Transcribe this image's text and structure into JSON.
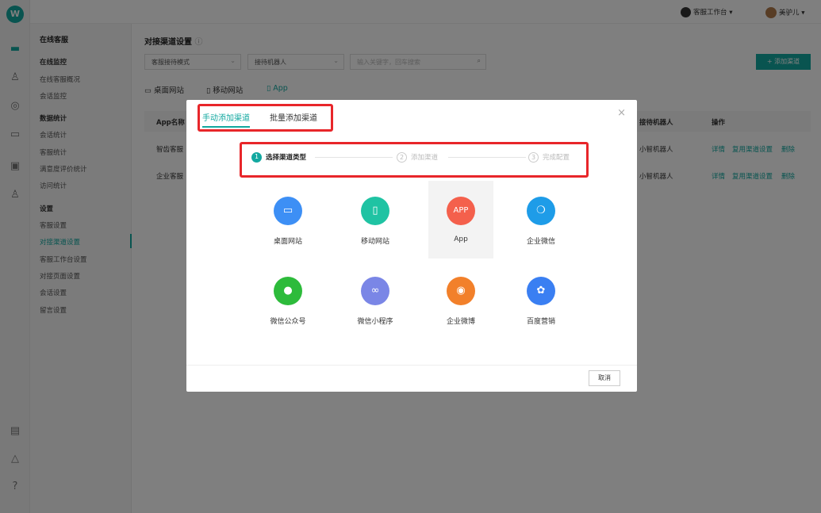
{
  "topbar": {
    "workspace": "客服工作台 ▾",
    "user": "美驴儿 ▾"
  },
  "sidebar": {
    "title": "在线客服",
    "groups": [
      {
        "heading": "在线监控",
        "items": [
          "在线客服概况",
          "会话监控"
        ]
      },
      {
        "heading": "数据统计",
        "items": [
          "会话统计",
          "客服统计",
          "满意度评价统计",
          "访问统计"
        ]
      },
      {
        "heading": "设置",
        "items": [
          "客服设置",
          "对接渠道设置",
          "客服工作台设置",
          "对接页面设置",
          "会话设置",
          "留言设置"
        ]
      }
    ]
  },
  "main": {
    "title": "对接渠道设置",
    "filter1": "客服接待模式",
    "filter2": "接待机器人",
    "search_placeholder": "输入关键字，回车搜索",
    "add_button": "+ 添加渠道",
    "channel_tabs": [
      "桌面网站",
      "移动网站",
      "App"
    ],
    "table_headers": {
      "name": "App名称",
      "robot": "接待机器人",
      "actions": "操作"
    },
    "rows": [
      {
        "name": "智齿客服",
        "robot": "小智机器人",
        "a1": "详情",
        "a2": "复用渠道设置",
        "a3": "删除"
      },
      {
        "name": "企业客服",
        "robot": "小智机器人",
        "a1": "详情",
        "a2": "复用渠道设置",
        "a3": "删除"
      }
    ]
  },
  "modal": {
    "tabs": [
      "手动添加渠道",
      "批量添加渠道"
    ],
    "steps": [
      {
        "num": "1",
        "label": "选择渠道类型"
      },
      {
        "num": "2",
        "label": "添加渠道"
      },
      {
        "num": "3",
        "label": "完成配置"
      }
    ],
    "channels": [
      {
        "label": "桌面网站",
        "color": "#3d8ff5"
      },
      {
        "label": "移动网站",
        "color": "#1fc3a3"
      },
      {
        "label": "App",
        "icon_text": "APP",
        "color": "#f4604c"
      },
      {
        "label": "企业微信",
        "color": "#1e9ce8"
      },
      {
        "label": "微信公众号",
        "color": "#2dbb3b"
      },
      {
        "label": "微信小程序",
        "color": "#7a86e6"
      },
      {
        "label": "企业微博",
        "color": "#f2802a"
      },
      {
        "label": "百度营销",
        "color": "#3a7ff2"
      }
    ],
    "cancel": "取消"
  },
  "colors": {
    "accent": "#12a8a0",
    "highlight": "#e8262a"
  }
}
